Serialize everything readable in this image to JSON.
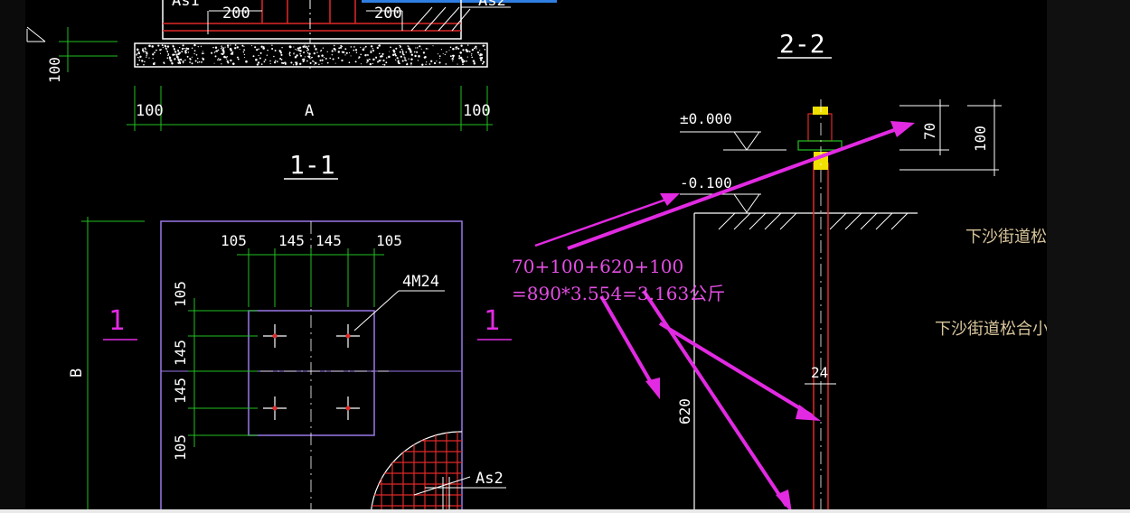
{
  "drawing": {
    "section_top": {
      "dims": [
        "200",
        "200"
      ],
      "labels": [
        "As1",
        "As2"
      ]
    },
    "section_1_1": {
      "title": "1-1",
      "dim_left": "100",
      "dim_bottom_left": "100",
      "dim_bottom_mid": "A",
      "dim_bottom_right": "100"
    },
    "section_2_2": {
      "title": "2-2",
      "level_top": "±0.000",
      "level_bottom": "-0.100",
      "dim_70": "70",
      "dim_100": "100",
      "dim_620": "620",
      "dim_24": "24"
    },
    "plan": {
      "top_dims": [
        "105",
        "145",
        "145",
        "105"
      ],
      "side_dims": [
        "105",
        "145",
        "145",
        "105"
      ],
      "bolt_label": "4M24",
      "dim_B": "B",
      "mark_left": "1",
      "mark_right": "1",
      "rebar_label": "As2"
    },
    "annotation": {
      "line1": "70+100+620+100",
      "line2": "=890*3.554=3.163公斤"
    },
    "side_notes": [
      "下沙街道松合小",
      "下沙街道松合小区老/"
    ]
  },
  "colors": {
    "background": "#000000",
    "dimension": "#21c021",
    "outline": "#9a78e8",
    "rebar": "#e02828",
    "annotation": "#e44ee4",
    "concrete_hatch": "#ffffff",
    "bolt_head": "#f0e000"
  }
}
